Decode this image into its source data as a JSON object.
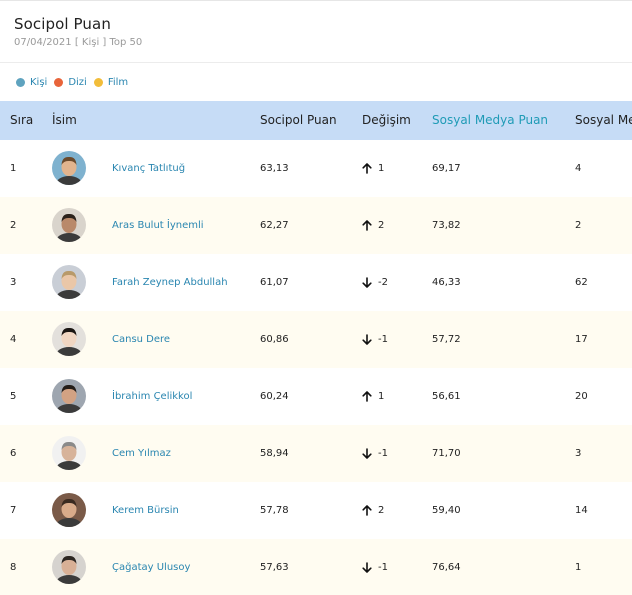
{
  "header": {
    "title": "Socipol Puan",
    "subtitle": "07/04/2021 [ Kişi ] Top 50"
  },
  "legend": [
    {
      "label": "Kişi",
      "color": "#5fa3bf"
    },
    {
      "label": "Dizi",
      "color": "#e8643a"
    },
    {
      "label": "Film",
      "color": "#f2bd3a"
    }
  ],
  "columns": {
    "rank": "Sıra",
    "name": "İsim",
    "score": "Socipol Puan",
    "change": "Değişim",
    "social_score": "Sosyal Medya Puan",
    "social_rank": "Sosyal Me"
  },
  "colors": {
    "header_bg": "#c6dcf6",
    "link": "#2a86b0",
    "accent_header": "#1f9bb6",
    "row_alt": "#fffcf1"
  },
  "rows": [
    {
      "rank": "1",
      "name": "Kıvanç Tatlıtuğ",
      "score": "63,13",
      "direction": "up",
      "delta": "1",
      "social_score": "69,17",
      "social_rank": "4"
    },
    {
      "rank": "2",
      "name": "Aras Bulut İynemli",
      "score": "62,27",
      "direction": "up",
      "delta": "2",
      "social_score": "73,82",
      "social_rank": "2"
    },
    {
      "rank": "3",
      "name": "Farah Zeynep Abdullah",
      "score": "61,07",
      "direction": "down",
      "delta": "-2",
      "social_score": "46,33",
      "social_rank": "62"
    },
    {
      "rank": "4",
      "name": "Cansu Dere",
      "score": "60,86",
      "direction": "down",
      "delta": "-1",
      "social_score": "57,72",
      "social_rank": "17"
    },
    {
      "rank": "5",
      "name": "İbrahim Çelikkol",
      "score": "60,24",
      "direction": "up",
      "delta": "1",
      "social_score": "56,61",
      "social_rank": "20"
    },
    {
      "rank": "6",
      "name": "Cem Yılmaz",
      "score": "58,94",
      "direction": "down",
      "delta": "-1",
      "social_score": "71,70",
      "social_rank": "3"
    },
    {
      "rank": "7",
      "name": "Kerem Bürsin",
      "score": "57,78",
      "direction": "up",
      "delta": "2",
      "social_score": "59,40",
      "social_rank": "14"
    },
    {
      "rank": "8",
      "name": "Çağatay Ulusoy",
      "score": "57,63",
      "direction": "down",
      "delta": "-1",
      "social_score": "76,64",
      "social_rank": "1"
    }
  ]
}
